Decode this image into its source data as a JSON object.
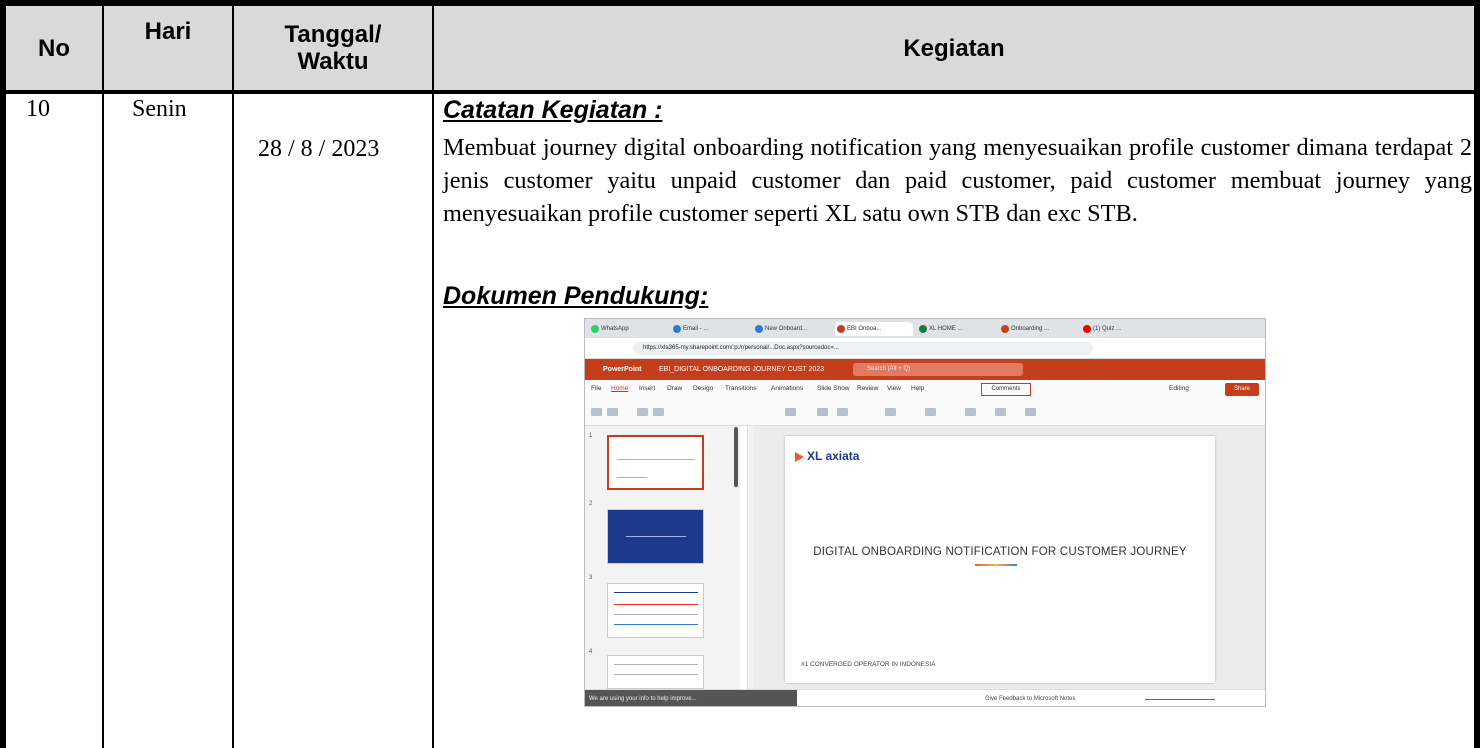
{
  "table": {
    "headers": {
      "no": "No",
      "hari": "Hari",
      "tanggal": "Tanggal/ Waktu",
      "kegiatan": "Kegiatan"
    },
    "row": {
      "no": "10",
      "hari": "Senin",
      "tanggal": "28 / 8 / 2023",
      "catatan_title": "Catatan Kegiatan :",
      "catatan_text": "Membuat journey digital onboarding notification yang menyesuaikan profile customer dimana terdapat 2 jenis customer yaitu unpaid customer dan paid customer, paid customer membuat journey yang menyesuaikan profile customer seperti XL satu own STB dan exc STB.",
      "dokumen_title": "Dokumen Pendukung:"
    }
  },
  "screenshot": {
    "tabs": [
      "WhatsApp",
      "Email - ...",
      "New Onboard...",
      "EBI Onboa...",
      "XL HOME ...",
      "Onboarding ...",
      "(1) Quiz ..."
    ],
    "url": "https://xla365-my.sharepoint.com/:p:/r/personal/...Doc.aspx?sourcedoc=...",
    "app_name": "PowerPoint",
    "doc_name": "EBI_DIGITAL ONBOARDING JOURNEY CUST 2023",
    "search_placeholder": "Search (Alt + Q)",
    "menus": [
      "File",
      "Home",
      "Insert",
      "Draw",
      "Design",
      "Transitions",
      "Animations",
      "Slide Show",
      "Review",
      "View",
      "Help"
    ],
    "comments_label": "Comments",
    "editing_label": "Editing",
    "share_label": "Share",
    "slide_numbers": [
      "1",
      "2",
      "3",
      "4"
    ],
    "slide": {
      "logo": "XL axiata",
      "title": "DIGITAL ONBOARDING NOTIFICATION FOR CUSTOMER JOURNEY",
      "footer": "#1 CONVERGED OPERATOR IN INDONESIA"
    },
    "status": {
      "left": "We are using your info to help improve...",
      "right": "Give Feedback to Microsoft    Notes"
    },
    "colors": {
      "powerpoint": "#c43e1c",
      "xl_blue": "#1e3a8a",
      "xl_orange": "#e85d2a"
    }
  }
}
